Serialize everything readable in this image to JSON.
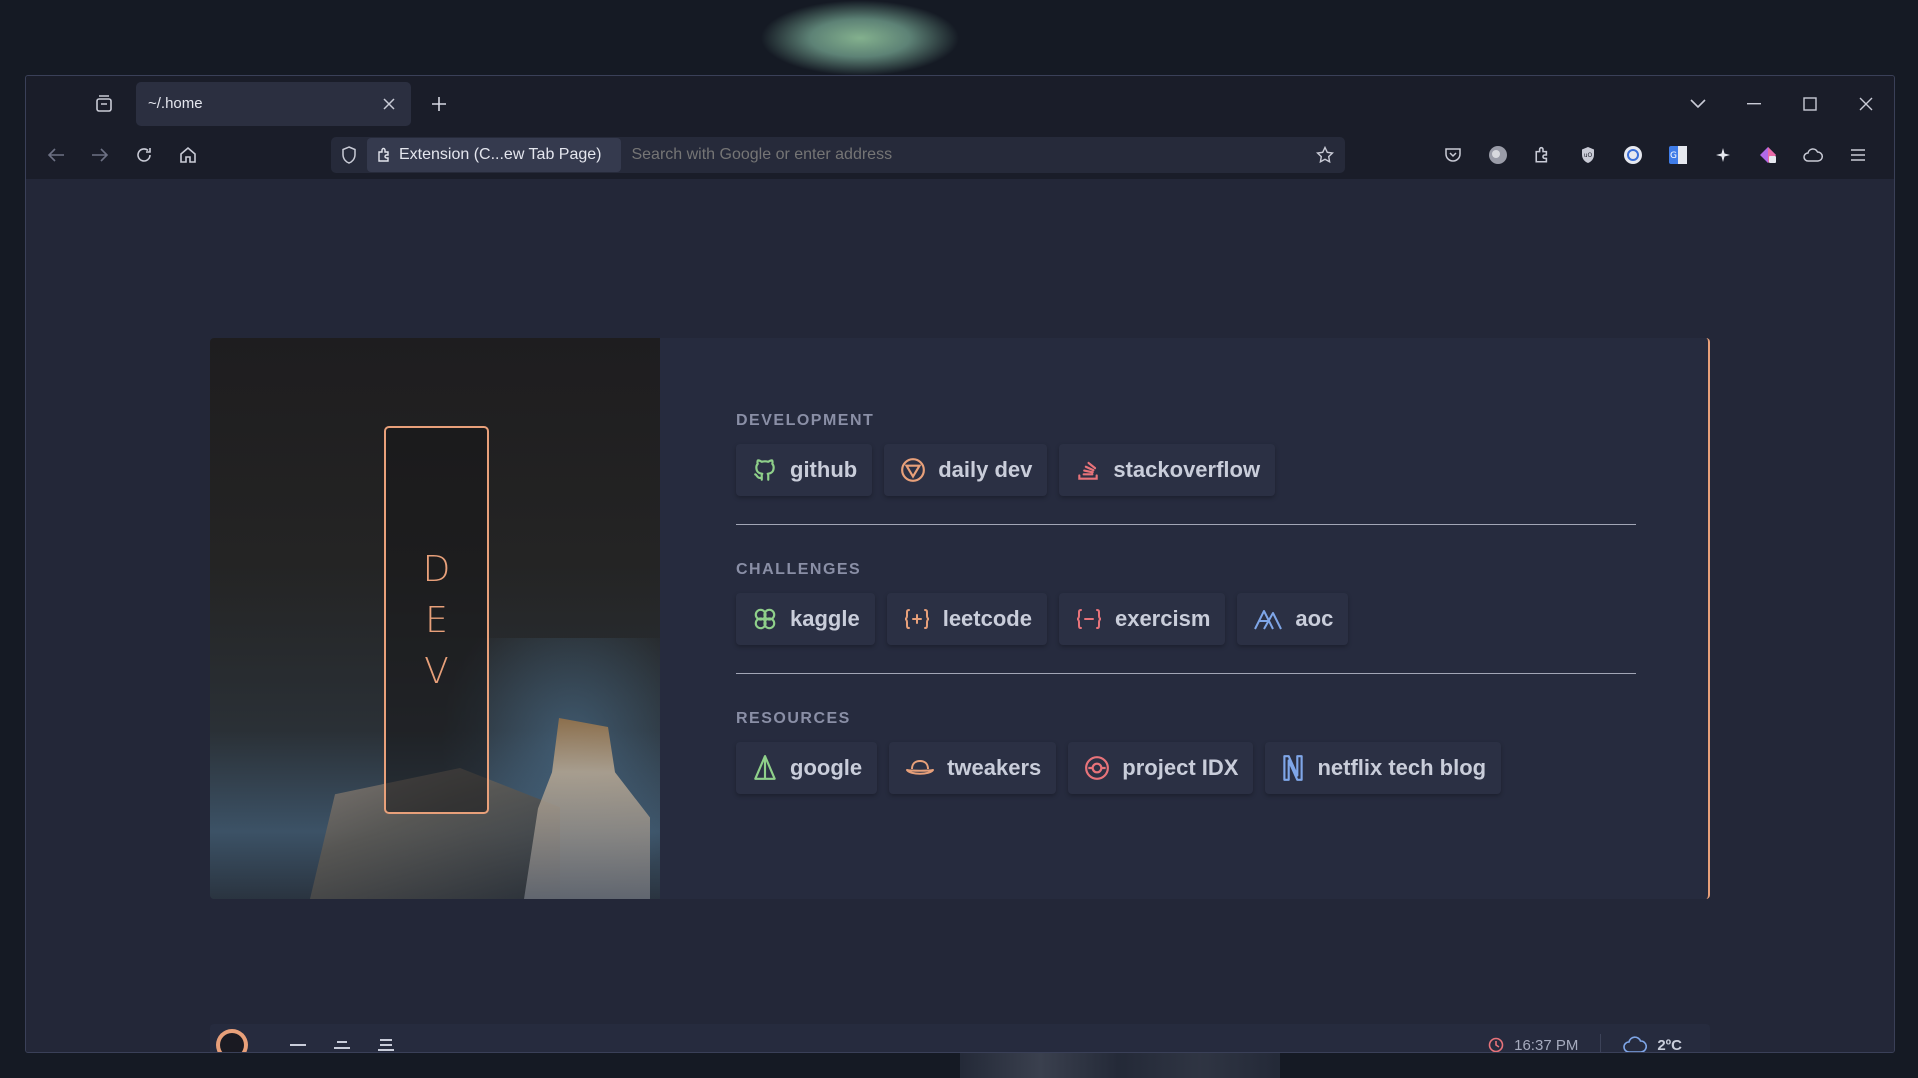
{
  "browser": {
    "tab_title": "~/.home",
    "url_extension_label": "Extension (C...ew Tab Page)",
    "url_placeholder": "Search with Google or enter address"
  },
  "page": {
    "art_label": [
      "D",
      "E",
      "V"
    ],
    "accent_color": "#e8a07a",
    "sections": [
      {
        "title": "DEVELOPMENT",
        "links": [
          {
            "label": "github",
            "icon": "github-icon",
            "color": "#8fd08a"
          },
          {
            "label": "daily dev",
            "icon": "dailydev-icon",
            "color": "#e8a07a"
          },
          {
            "label": "stackoverflow",
            "icon": "stackoverflow-icon",
            "color": "#e8737a"
          }
        ]
      },
      {
        "title": "CHALLENGES",
        "links": [
          {
            "label": "kaggle",
            "icon": "kaggle-icon",
            "color": "#8fd08a"
          },
          {
            "label": "leetcode",
            "icon": "leetcode-icon",
            "color": "#e8a07a"
          },
          {
            "label": "exercism",
            "icon": "exercism-icon",
            "color": "#e8737a"
          },
          {
            "label": "aoc",
            "icon": "aoc-icon",
            "color": "#7fa6e8"
          }
        ]
      },
      {
        "title": "RESOURCES",
        "links": [
          {
            "label": "google",
            "icon": "google-icon",
            "color": "#8fd08a"
          },
          {
            "label": "tweakers",
            "icon": "tweakers-icon",
            "color": "#e8a07a"
          },
          {
            "label": "project IDX",
            "icon": "project-idx-icon",
            "color": "#e8737a"
          },
          {
            "label": "netflix tech blog",
            "icon": "netflix-icon",
            "color": "#7fa6e8"
          }
        ]
      }
    ]
  },
  "statusbar": {
    "time": "16:37 PM",
    "temperature": "2ºC"
  }
}
